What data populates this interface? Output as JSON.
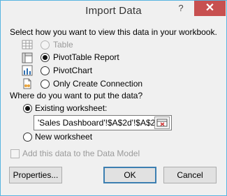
{
  "window": {
    "title": "Import Data",
    "help_glyph": "?",
    "close_glyph": "✕"
  },
  "view": {
    "heading": "Select how you want to view this data in your workbook.",
    "options": [
      {
        "label": "Table",
        "icon": "table-icon",
        "checked": false,
        "enabled": false
      },
      {
        "label": "PivotTable Report",
        "icon": "pivottable-icon",
        "checked": true,
        "enabled": true
      },
      {
        "label": "PivotChart",
        "icon": "pivotchart-icon",
        "checked": false,
        "enabled": true
      },
      {
        "label": "Only Create Connection",
        "icon": "connection-icon",
        "checked": false,
        "enabled": true
      }
    ]
  },
  "location": {
    "heading": "Where do you want to put the data?",
    "existing_label": "Existing worksheet:",
    "existing_checked": true,
    "range_value": "'Sales Dashboard'!$A$2d'!$A$2",
    "new_label": "New worksheet",
    "new_checked": false
  },
  "data_model": {
    "label": "Add this data to the Data Model",
    "checked": false,
    "enabled": false
  },
  "buttons": {
    "properties": "Properties...",
    "ok": "OK",
    "cancel": "Cancel"
  },
  "colors": {
    "accent_border": "#58b5e0",
    "close_bg": "#c75050",
    "disabled_text": "#9a9a9a",
    "default_button_border": "#3c7fb1"
  }
}
